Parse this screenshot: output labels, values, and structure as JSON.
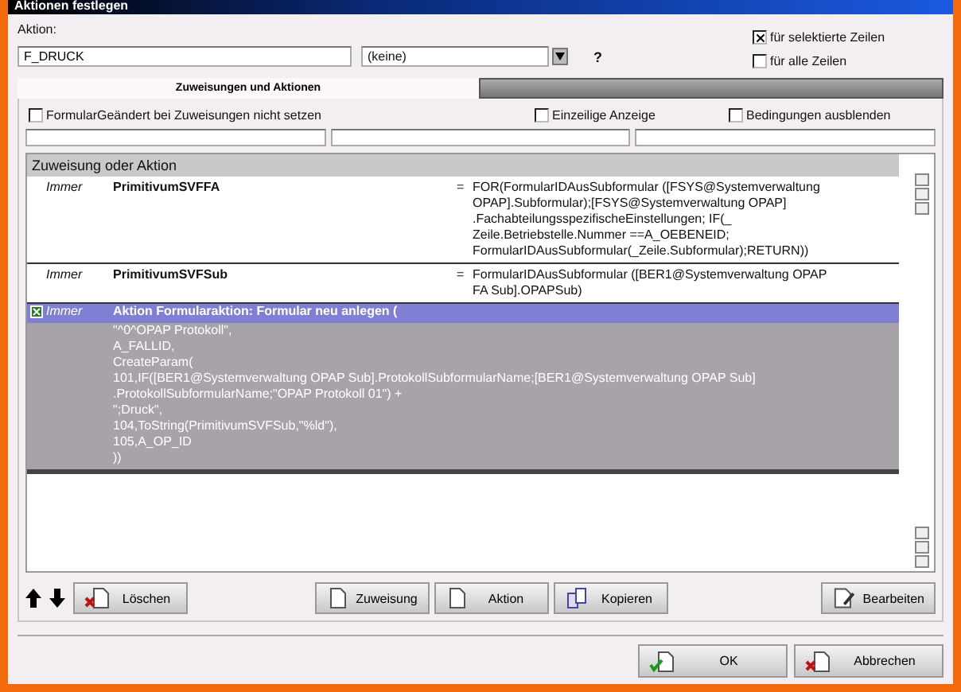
{
  "window": {
    "title": "Aktionen festlegen"
  },
  "action_label": "Aktion:",
  "action_field": {
    "value": "F_DRUCK"
  },
  "dropdown": {
    "value": "(keine)"
  },
  "help": "?",
  "scope": [
    {
      "label": "für selektierte Zeilen",
      "checked": true
    },
    {
      "label": "für alle Zeilen",
      "checked": false
    }
  ],
  "tabs": [
    {
      "label": "Zuweisungen und Aktionen",
      "selected": true
    },
    {
      "selected": false
    }
  ],
  "options": [
    {
      "label": "FormularGeändert bei Zuweisungen nicht setzen",
      "checked": false
    },
    {
      "label": "Einzeilige Anzeige",
      "checked": false
    },
    {
      "label": "Bedingungen ausblenden",
      "checked": false
    }
  ],
  "table": {
    "header": "Zuweisung oder Aktion",
    "rows": [
      {
        "kind": "assignment",
        "selected": false,
        "condition": "Immer",
        "name": "PrimitivumSVFFA",
        "operator": "=",
        "lines": [
          "FOR(FormularIDAusSubformular ([FSYS@Systemverwaltung",
          "OPAP].Subformular);[FSYS@Systemverwaltung OPAP]",
          ".FachabteilungsspezifischeEinstellungen; IF(_",
          "Zeile.Betriebstelle.Nummer ==A_OEBENEID;",
          "FormularIDAusSubformular(_Zeile.Subformular);RETURN))"
        ]
      },
      {
        "kind": "assignment",
        "selected": false,
        "condition": "Immer",
        "name": "PrimitivumSVFSub",
        "operator": "=",
        "lines": [
          "FormularIDAusSubformular ([BER1@Systemverwaltung OPAP",
          "FA Sub].OPAPSub)"
        ]
      },
      {
        "kind": "action",
        "selected": true,
        "condition": "Immer",
        "name": "Aktion Formularaktion: Formular neu anlegen (",
        "lines": [
          "\"^0^OPAP Protokoll\",",
          "A_FALLID,",
          "CreateParam(",
          "101,IF([BER1@Systemverwaltung OPAP Sub].ProtokollSubformularName;[BER1@Systemverwaltung OPAP Sub]",
          ".ProtokollSubformularName;\"OPAP Protokoll 01\") +",
          "\";Druck\",",
          "104,ToString(PrimitivumSVFSub,\"%ld\"),",
          "105,A_OP_ID",
          "))"
        ]
      }
    ]
  },
  "toolbar": [
    {
      "label": "Löschen",
      "kind": "delete"
    },
    {
      "label": "Zuweisung",
      "kind": "new"
    },
    {
      "label": "Aktion",
      "kind": "new"
    },
    {
      "label": "Kopieren",
      "kind": "copy"
    },
    {
      "label": "Bearbeiten",
      "kind": "edit"
    }
  ],
  "dialog_buttons": [
    {
      "label": "OK",
      "kind": "confirm"
    },
    {
      "label": "Abbrechen",
      "kind": "cancel"
    }
  ]
}
